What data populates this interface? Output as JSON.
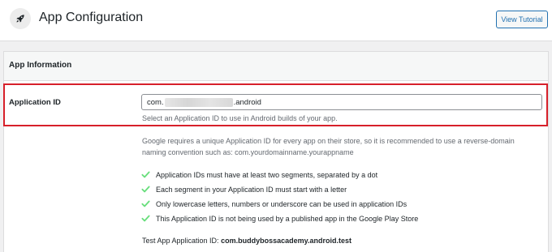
{
  "header": {
    "title": "App Configuration",
    "tutorial_button": "View Tutorial",
    "icon": "rocket-icon"
  },
  "section": {
    "title": "App Information"
  },
  "application_id": {
    "label": "Application ID",
    "value_prefix": "com.",
    "value_suffix": ".android",
    "help": "Select an Application ID to use in Android builds of your app.",
    "description": "Google requires a unique Application ID for every app on their store, so it is recommended to use a reverse-domain naming convention such as: com.yourdomainname.yourappname"
  },
  "rules": [
    {
      "text": "Application IDs must have at least two segments, separated by a dot"
    },
    {
      "text": "Each segment in your Application ID must start with a letter"
    },
    {
      "text": "Only lowercase letters, numbers or underscore can be used in application IDs"
    },
    {
      "text": "This Application ID is not being used by a published app in the Google Play Store"
    }
  ],
  "test_app": {
    "label": "Test App Application ID:",
    "value": "com.buddybossacademy.android.test"
  },
  "colors": {
    "accent": "#2271b1",
    "check": "#68de7c",
    "highlight": "#d7202a"
  }
}
